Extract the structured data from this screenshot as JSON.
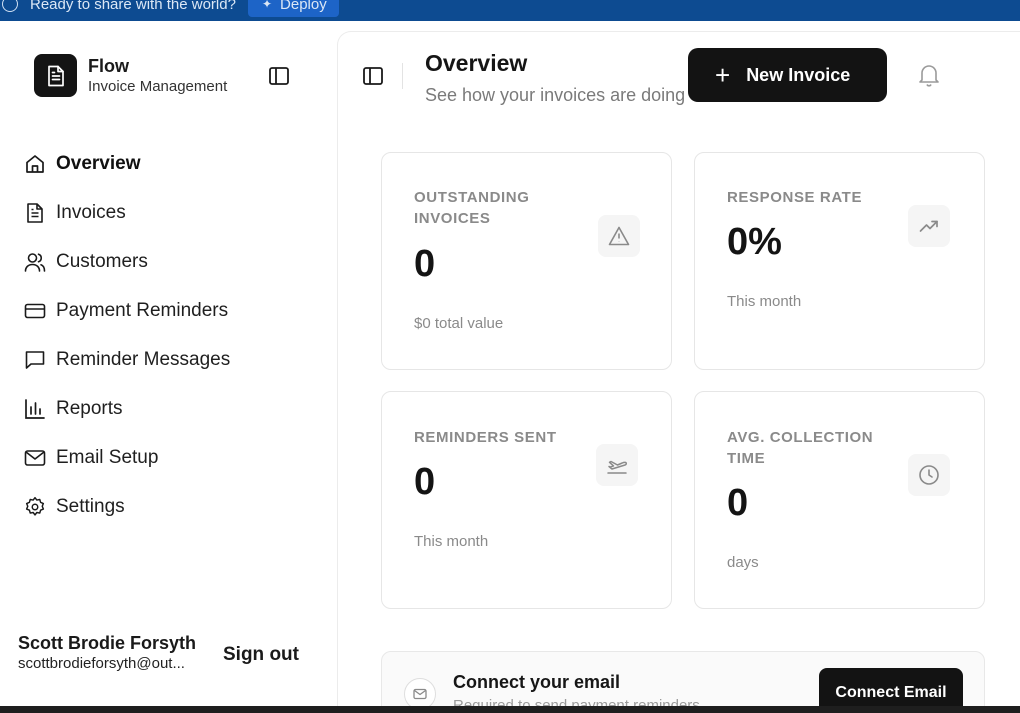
{
  "banner": {
    "text": "Ready to share with the world?",
    "deploy_label": "Deploy"
  },
  "brand": {
    "name": "Flow",
    "subtitle": "Invoice Management"
  },
  "sidebar": {
    "items": [
      {
        "label": "Overview",
        "icon": "home-icon",
        "active": true
      },
      {
        "label": "Invoices",
        "icon": "file-text-icon"
      },
      {
        "label": "Customers",
        "icon": "users-icon"
      },
      {
        "label": "Payment Reminders",
        "icon": "credit-card-icon"
      },
      {
        "label": "Reminder Messages",
        "icon": "message-square-icon"
      },
      {
        "label": "Reports",
        "icon": "bar-chart-icon"
      },
      {
        "label": "Email Setup",
        "icon": "mail-icon"
      },
      {
        "label": "Settings",
        "icon": "gear-icon"
      }
    ]
  },
  "user": {
    "name": "Scott Brodie Forsyth",
    "email": "scottbrodieforsyth@out...",
    "signout_label": "Sign out"
  },
  "header": {
    "title": "Overview",
    "subtitle": "See how your invoices are doing",
    "new_invoice_label": "New Invoice"
  },
  "stats": [
    {
      "title": "OUTSTANDING INVOICES",
      "value": "0",
      "note": "$0 total value",
      "icon": "alert-triangle-icon"
    },
    {
      "title": "RESPONSE RATE",
      "value": "0%",
      "note": "This month",
      "icon": "trending-up-icon"
    },
    {
      "title": "REMINDERS SENT",
      "value": "0",
      "note": "This month",
      "icon": "plane-icon"
    },
    {
      "title": "AVG. COLLECTION TIME",
      "value": "0",
      "note": "days",
      "icon": "clock-icon"
    }
  ],
  "connect": {
    "title": "Connect your email",
    "subtitle": "Required to send payment reminders",
    "button_label": "Connect Email"
  },
  "colors": {
    "banner": "#0d4b91",
    "primary": "#131313",
    "muted": "#8a8a8a"
  }
}
